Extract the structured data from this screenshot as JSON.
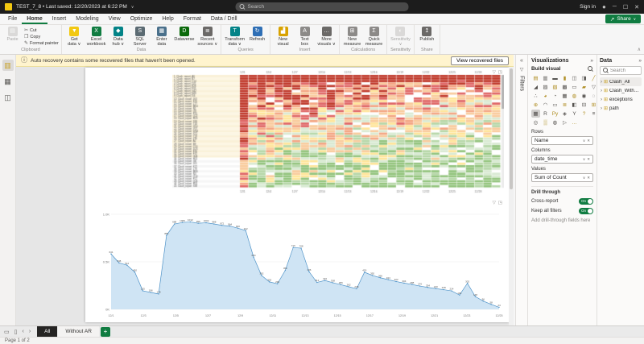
{
  "accent": "#107c41",
  "titlebar": {
    "title": "TEST_7_8 • Last saved: 12/20/2023 at 6:22 PM",
    "title_caret": "∨",
    "search_placeholder": "Search",
    "sign_in": "Sign in",
    "window_controls": {
      "minimize": "─",
      "maximize": "☐",
      "close": "✕"
    }
  },
  "menubar": {
    "items": [
      "File",
      "Home",
      "Insert",
      "Modeling",
      "View",
      "Optimize",
      "Help",
      "Format",
      "Data / Drill"
    ],
    "active_item": "Home",
    "share_label": "Share"
  },
  "ribbon": {
    "groups": [
      {
        "label": "Clipboard",
        "big": [
          {
            "label": "Paste",
            "glyph": "▤",
            "color": "#b5b2af",
            "disabled": true
          }
        ],
        "small": [
          {
            "label": "Cut",
            "glyph": "✂"
          },
          {
            "label": "Copy",
            "glyph": "❐"
          },
          {
            "label": "Format painter",
            "glyph": "✎"
          }
        ]
      },
      {
        "label": "Data",
        "big": [
          {
            "label": "Get\ndata ∨",
            "glyph": "▼",
            "color": "#f2c811"
          },
          {
            "label": "Excel\nworkbook",
            "glyph": "X",
            "color": "#107c41"
          },
          {
            "label": "Data\nhub ∨",
            "glyph": "◆",
            "color": "#038387"
          },
          {
            "label": "SQL\nServer",
            "glyph": "S",
            "color": "#5c6b73"
          },
          {
            "label": "Enter\ndata",
            "glyph": "▦",
            "color": "#4a708b"
          },
          {
            "label": "Dataverse",
            "glyph": "D",
            "color": "#0b6a0b"
          },
          {
            "label": "Recent\nsources ∨",
            "glyph": "≣",
            "color": "#6b6967"
          }
        ]
      },
      {
        "label": "Queries",
        "big": [
          {
            "label": "Transform\ndata ∨",
            "glyph": "T",
            "color": "#038387"
          },
          {
            "label": "Refresh",
            "glyph": "↻",
            "color": "#2f6fb5"
          }
        ]
      },
      {
        "label": "Insert",
        "big": [
          {
            "label": "New\nvisual",
            "glyph": "▟",
            "color": "#d8a200"
          },
          {
            "label": "Text\nbox",
            "glyph": "A",
            "color": "#8c8a88"
          },
          {
            "label": "More\nvisuals ∨",
            "glyph": "…",
            "color": "#6b6967"
          }
        ]
      },
      {
        "label": "Calculations",
        "big": [
          {
            "label": "New\nmeasure",
            "glyph": "⊞",
            "color": "#8c8a88"
          },
          {
            "label": "Quick\nmeasure",
            "glyph": "Σ",
            "color": "#8c8a88"
          }
        ]
      },
      {
        "label": "Sensitivity",
        "big": [
          {
            "label": "Sensitivity\n∨",
            "glyph": "◐",
            "color": "#b5b2af",
            "disabled": true
          }
        ]
      },
      {
        "label": "Share",
        "big": [
          {
            "label": "Publish",
            "glyph": "↥",
            "color": "#6b6967"
          }
        ]
      }
    ]
  },
  "notification": {
    "text": "Auto recovery contains some recovered files that haven't been opened.",
    "button": "View recovered files"
  },
  "view_rail": {
    "items": [
      {
        "name": "report-view",
        "glyph": "▥",
        "color": "#c9a227",
        "active": true
      },
      {
        "name": "table-view",
        "glyph": "▦",
        "color": "#5a5855",
        "active": false
      },
      {
        "name": "model-view",
        "glyph": "◫",
        "color": "#5a5855",
        "active": false
      }
    ]
  },
  "canvas": {
    "header_icons": {
      "filter": "▽",
      "focus": "◳"
    },
    "matrix": {
      "rows": 45,
      "cols": 30,
      "seed": 13,
      "row_label": "Clash_report",
      "tick_prefix": "12/",
      "palette": [
        "#c0392b",
        "#e06666",
        "#f4a582",
        "#f9cb9c",
        "#ffe599",
        "#d9ead3",
        "#b6d7a8",
        "#93c47d"
      ]
    },
    "line_chart": {
      "type": "area",
      "y_max": 1100,
      "y_ticks": [
        "0K",
        "0.5K",
        "1.0K"
      ],
      "values": [
        641,
        538,
        512,
        430,
        215,
        196,
        178,
        856,
        988,
        1005,
        1012,
        996,
        1002,
        988,
        972,
        964,
        940,
        912,
        604,
        392,
        318,
        296,
        452,
        716,
        708,
        436,
        312,
        334,
        308,
        286,
        262,
        238,
        430,
        392,
        366,
        344,
        322,
        304,
        288,
        270,
        254,
        240,
        228,
        214,
        166,
        302,
        148,
        96,
        58,
        24
      ],
      "x_labels": [
        "12/1",
        "12/3",
        "12/5",
        "12/7",
        "12/9",
        "12/11",
        "12/13",
        "12/15",
        "12/17",
        "12/19",
        "12/21",
        "12/23",
        "12/25"
      ],
      "fill": "#cfe4f4",
      "stroke": "#4f93c8"
    }
  },
  "filters_panel": {
    "title": "Filters",
    "collapse_icon": "«",
    "funnel_icon": "▽"
  },
  "visualizations_panel": {
    "title": "Visualizations",
    "collapse_icon": "»",
    "build_label": "Build visual",
    "selected_icon": "matrix",
    "icons": [
      {
        "name": "stacked-bar",
        "glyph": "▤"
      },
      {
        "name": "stacked-column",
        "glyph": "▥"
      },
      {
        "name": "clustered-bar",
        "glyph": "▬"
      },
      {
        "name": "clustered-column",
        "glyph": "▮"
      },
      {
        "name": "100-stacked-bar",
        "glyph": "◫"
      },
      {
        "name": "100-stacked-column",
        "glyph": "◨"
      },
      {
        "name": "line-chart",
        "glyph": "╱"
      },
      {
        "name": "area-chart",
        "glyph": "◢"
      },
      {
        "name": "stacked-area",
        "glyph": "▨"
      },
      {
        "name": "line-stacked-column",
        "glyph": "▧"
      },
      {
        "name": "line-clustered-column",
        "glyph": "▩"
      },
      {
        "name": "ribbon-chart",
        "glyph": "▭"
      },
      {
        "name": "waterfall",
        "glyph": "▰"
      },
      {
        "name": "funnel",
        "glyph": "▽"
      },
      {
        "name": "scatter",
        "glyph": "∴"
      },
      {
        "name": "pie",
        "glyph": "◕"
      },
      {
        "name": "donut",
        "glyph": "◔"
      },
      {
        "name": "treemap",
        "glyph": "▦"
      },
      {
        "name": "map",
        "glyph": "◍"
      },
      {
        "name": "filled-map",
        "glyph": "◉"
      },
      {
        "name": "shape-map",
        "glyph": "◌"
      },
      {
        "name": "azure-map",
        "glyph": "⊕"
      },
      {
        "name": "gauge",
        "glyph": "◠"
      },
      {
        "name": "card",
        "glyph": "▭"
      },
      {
        "name": "multi-row-card",
        "glyph": "≣"
      },
      {
        "name": "kpi",
        "glyph": "◧"
      },
      {
        "name": "slicer",
        "glyph": "⊟"
      },
      {
        "name": "table",
        "glyph": "⊞"
      },
      {
        "name": "matrix",
        "glyph": "▦"
      },
      {
        "name": "r-script",
        "glyph": "R"
      },
      {
        "name": "python",
        "glyph": "Py"
      },
      {
        "name": "key-influencers",
        "glyph": "◈"
      },
      {
        "name": "decomposition-tree",
        "glyph": "Y"
      },
      {
        "name": "qa",
        "glyph": "?"
      },
      {
        "name": "smart-narrative",
        "glyph": "≡"
      },
      {
        "name": "metrics",
        "glyph": "◎"
      },
      {
        "name": "paginated-report",
        "glyph": "▒"
      },
      {
        "name": "arcgis",
        "glyph": "◍"
      },
      {
        "name": "power-apps",
        "glyph": "▷"
      },
      {
        "name": "more-visuals",
        "glyph": "…"
      }
    ],
    "wells": {
      "rows_label": "Rows",
      "rows_value": "Name",
      "columns_label": "Columns",
      "columns_value": "date_time",
      "values_label": "Values",
      "values_value": "Sum of Count"
    },
    "drill": {
      "label": "Drill through",
      "cross_report": "Cross-report",
      "cross_report_state": "On",
      "keep_filters": "Keep all filters",
      "keep_filters_state": "On",
      "hint": "Add drill-through fields here"
    }
  },
  "data_panel": {
    "title": "Data",
    "collapse_icon": "»",
    "search_placeholder": "Search",
    "tables": [
      {
        "name": "Clash_All",
        "selected": true
      },
      {
        "name": "Clash_Without_AR",
        "selected": false
      },
      {
        "name": "exceptions",
        "selected": false
      },
      {
        "name": "path",
        "selected": false
      }
    ]
  },
  "bottom_bar": {
    "nav_prev": "‹",
    "nav_next": "›",
    "tabs": [
      {
        "label": "All",
        "active": true
      },
      {
        "label": "Without AR",
        "active": false
      }
    ],
    "new_page": "+"
  },
  "status_bar": {
    "page_status": "Page 1 of 2"
  }
}
